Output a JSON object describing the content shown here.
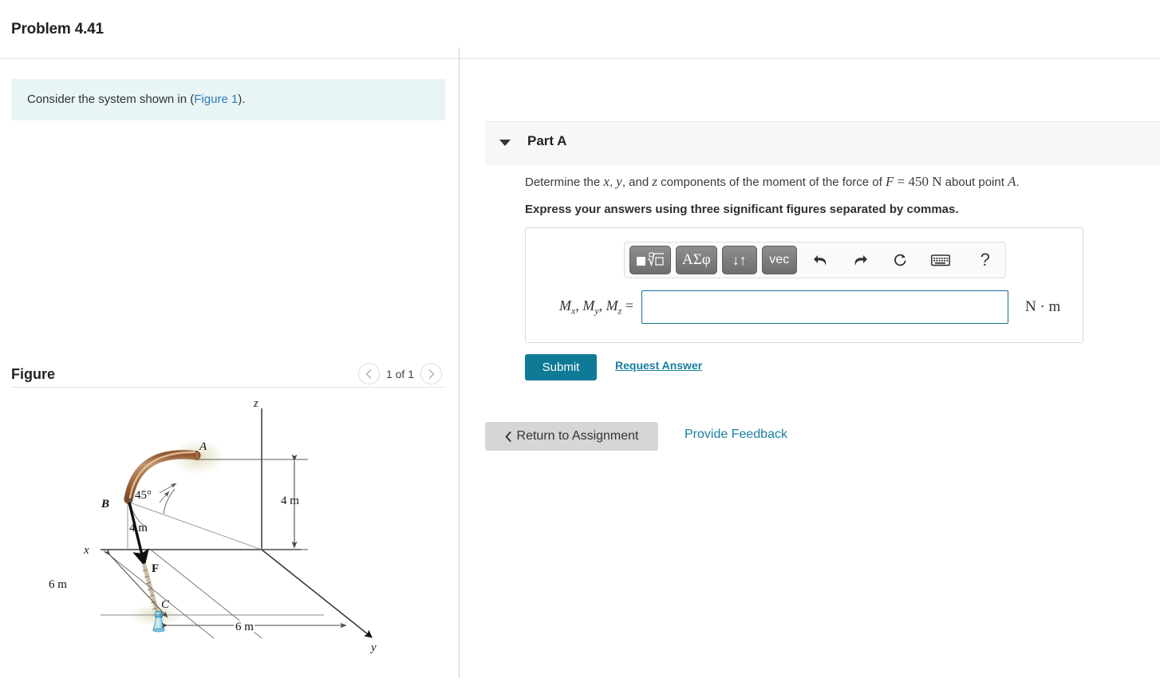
{
  "header": {
    "problem_title": "Problem 4.41"
  },
  "left": {
    "intro_prefix": "Consider the system shown in (",
    "intro_link": "Figure 1",
    "intro_suffix": ").",
    "figure_title": "Figure",
    "figure_counter": "1 of 1",
    "prev_icon": "chevron-left-icon",
    "next_icon": "chevron-right-icon"
  },
  "part": {
    "label": "Part A",
    "toggle_icon": "caret-down-icon",
    "question": "Determine the x, y, and z components of the moment of the force of F = 450  N about point A.",
    "question_parts": {
      "p1": "Determine the ",
      "v_x": "x",
      "c1": ", ",
      "v_y": "y",
      "c2": ", and ",
      "v_z": "z",
      "p2": " components of the moment of the force of ",
      "v_F": "F",
      "eq": " = 450 ",
      "unit": "N",
      "p3": " about point ",
      "v_A": "A",
      "period": "."
    },
    "instruction": "Express your answers using three significant figures separated by commas."
  },
  "toolbar": {
    "buttons": [
      {
        "name": "template-radical-button",
        "label": "■√□"
      },
      {
        "name": "greek-symbols-button",
        "label": "ΑΣφ"
      },
      {
        "name": "arrows-button",
        "label": "↓↑"
      },
      {
        "name": "vector-button",
        "label": "vec"
      }
    ],
    "icons": [
      {
        "name": "undo-icon",
        "glyph": "↶"
      },
      {
        "name": "redo-icon",
        "glyph": "↷"
      },
      {
        "name": "reset-icon",
        "glyph": "↻"
      },
      {
        "name": "keyboard-icon",
        "glyph": "⌨"
      },
      {
        "name": "help-icon",
        "glyph": "?"
      }
    ]
  },
  "answer": {
    "label_mx": "M",
    "label_sub_x": "x",
    "label_my": "M",
    "label_sub_y": "y",
    "label_mz": "M",
    "label_sub_z": "z",
    "label_full": "Mx , My , Mz =",
    "value": "",
    "placeholder": "",
    "unit": "N · m"
  },
  "actions": {
    "submit_label": "Submit",
    "request_answer_label": "Request Answer",
    "return_label": "Return to Assignment",
    "return_icon": "chevron-left-icon",
    "feedback_label": "Provide Feedback"
  },
  "colors": {
    "accent_teal": "#0f7a96",
    "link_blue": "#1a7fa0",
    "callout_bg": "#e8f5f4",
    "part_header_bg": "#f7f7f7",
    "rod_brown": "#c08a5e",
    "support_blue": "#7fc4e0"
  },
  "figure": {
    "axis_x": "x",
    "axis_y": "y",
    "axis_z": "z",
    "point_a": "A",
    "point_b": "B",
    "point_c": "C",
    "force_label": "F",
    "angle_label": "45°",
    "dim_ab_vertical": "4 m",
    "dim_b_radius": "4 m",
    "dim_x_offset": "6 m",
    "dim_y_offset": "6 m"
  }
}
